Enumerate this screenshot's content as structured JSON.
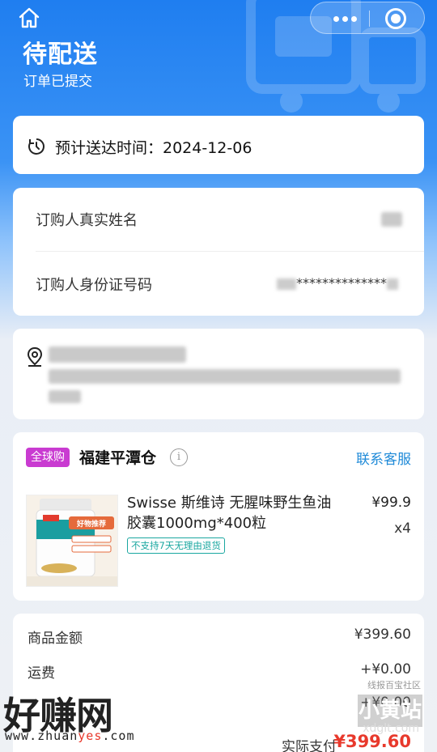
{
  "header": {
    "status_title": "待配送",
    "status_subtitle": "订单已提交"
  },
  "eta": {
    "text": "预计送达时间：2024-12-06"
  },
  "buyer": {
    "name_label": "订购人真实姓名",
    "id_label": "订购人身份证号码",
    "id_masked": "**************"
  },
  "store": {
    "badge": "全球购",
    "name": "福建平潭仓",
    "contact_label": "联系客服"
  },
  "product": {
    "title": "Swisse 斯维诗 无腥味野生鱼油胶囊1000mg*400粒",
    "tag": "不支持7天无理由退货",
    "price": "¥99.9",
    "quantity": "x4",
    "image_label": "好物推荐"
  },
  "summary": {
    "goods_label": "商品金额",
    "goods_value": "¥399.60",
    "shipping_label": "运费",
    "shipping_value": "+¥0.00",
    "pack_value": "+¥0.00",
    "total_label": "实际支付",
    "total_value": "¥399.60"
  },
  "watermark": {
    "main": "好赚网",
    "url_prefix": "www.zhuan",
    "url_highlight": "yes",
    "url_suffix": ".com",
    "right_top": "线报百宝社区",
    "right_main": "小黄站",
    "right_url": "xdglt.com"
  },
  "colors": {
    "header_blue": "#1f7ef0",
    "link_blue": "#1f8ad8",
    "badge_purple": "#c93bd1",
    "price_red": "#e8392c",
    "tag_teal": "#1aa7a0"
  }
}
